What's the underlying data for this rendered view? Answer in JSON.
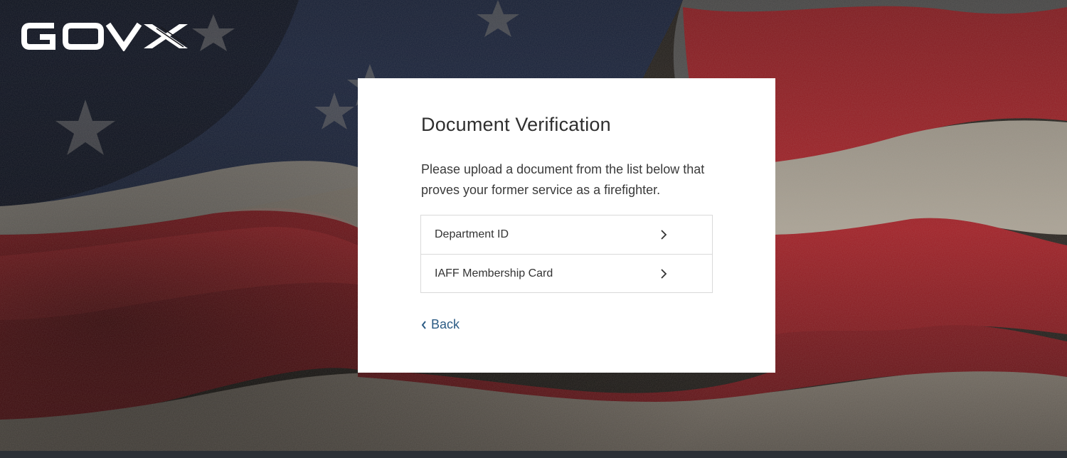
{
  "brand": {
    "logo_text": "GOVX"
  },
  "card": {
    "title": "Document Verification",
    "description": "Please upload a document from the list below that proves your former service as a firefighter.",
    "documents": [
      {
        "label": "Department ID",
        "icon": "chevron-right-icon"
      },
      {
        "label": "IAFF Membership Card",
        "icon": "chevron-right-icon"
      }
    ],
    "back_label": "Back",
    "back_icon": "chevron-left-icon"
  },
  "colors": {
    "card_bg": "#ffffff",
    "link": "#2b5b84",
    "flag_red": "#b3232b",
    "flag_blue": "#1f2f52",
    "flag_white": "#bcb5a8"
  }
}
